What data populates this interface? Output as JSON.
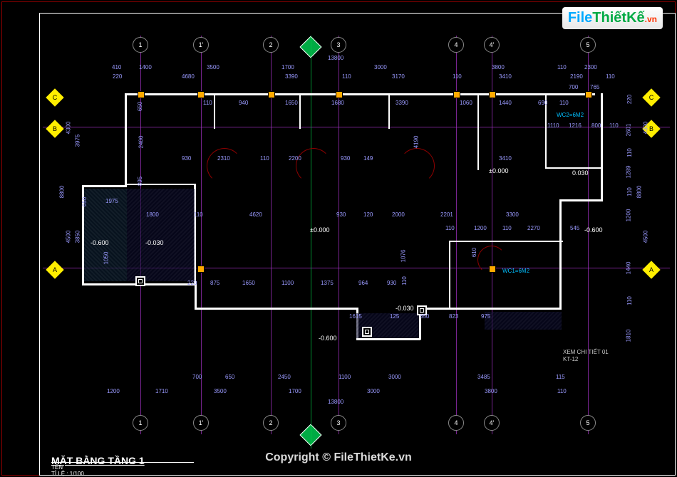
{
  "watermark": {
    "file": "File",
    "thiet": "Thiết",
    "ke": "Kế",
    "vn": ".vn"
  },
  "title": "MẶT BẰNG TẦNG 1",
  "title_block": {
    "ten_label": "TÊN",
    "scale_label": "TỈ LỆ :",
    "scale_value": "1/100"
  },
  "copyright": "Copyright © FileThietKe.vn",
  "grid": {
    "vertical_labels": [
      "1",
      "1'",
      "2",
      "3",
      "4",
      "4'",
      "5"
    ],
    "horizontal_labels": [
      "A",
      "B",
      "C"
    ]
  },
  "dimensions": {
    "top_overall": "13800",
    "top_row1": [
      "410",
      "1400",
      "3500",
      "1700",
      "3000",
      "3800",
      "110",
      "2300"
    ],
    "top_row2": [
      "220",
      "4680",
      "3390",
      "110",
      "3170",
      "110",
      "3410",
      "2190",
      "110"
    ],
    "top_row3": [
      "110",
      "940",
      "1650",
      "1680",
      "3390",
      "1060",
      "1440",
      "690",
      "110",
      "700",
      "765"
    ],
    "left_col": [
      "4300",
      "8800",
      "3975",
      "4500",
      "3850"
    ],
    "left_col2": [
      "650",
      "2400",
      "895",
      "650",
      "1050"
    ],
    "right_col": [
      "4300",
      "8800",
      "4500"
    ],
    "right_col2": [
      "220",
      "2601",
      "110",
      "1289",
      "110",
      "1200",
      "1440",
      "110",
      "1810"
    ],
    "interior1": [
      "930",
      "2310",
      "110",
      "2200",
      "930",
      "149",
      "3410"
    ],
    "interior2": [
      "1975",
      "1800",
      "110",
      "4620",
      "930",
      "120",
      "2000",
      "2201",
      "3300"
    ],
    "interior3": [
      "110",
      "1200",
      "110",
      "2270",
      "545"
    ],
    "interior4": [
      "220",
      "875",
      "1650",
      "1100",
      "1375",
      "964",
      "930"
    ],
    "interior5": [
      "1615",
      "125",
      "650",
      "823",
      "975"
    ],
    "bottom_row1": [
      "700",
      "650",
      "2450",
      "1100",
      "3000",
      "3485",
      "115"
    ],
    "bottom_row2": [
      "1200",
      "1710",
      "3500",
      "1700",
      "3000",
      "3800",
      "110"
    ],
    "bottom_overall": "13800",
    "vert_interior": [
      "4190",
      "1076",
      "110",
      "610"
    ]
  },
  "levels": {
    "zero1": "±0.000",
    "zero2": "±0.000",
    "step1": "-0.030",
    "step2": "-0.600",
    "step3": "-0.030",
    "step4": "-0.600",
    "step5": "-0.600",
    "step6": "0.030"
  },
  "rooms": {
    "wc1": "WC1=6M2",
    "wc2": "WC2=6M2",
    "wc_dims": [
      "1110",
      "1216",
      "800",
      "110"
    ]
  },
  "notes": {
    "detail": "XEM CHI TIẾT 01",
    "detail_ref": "KT-12"
  }
}
